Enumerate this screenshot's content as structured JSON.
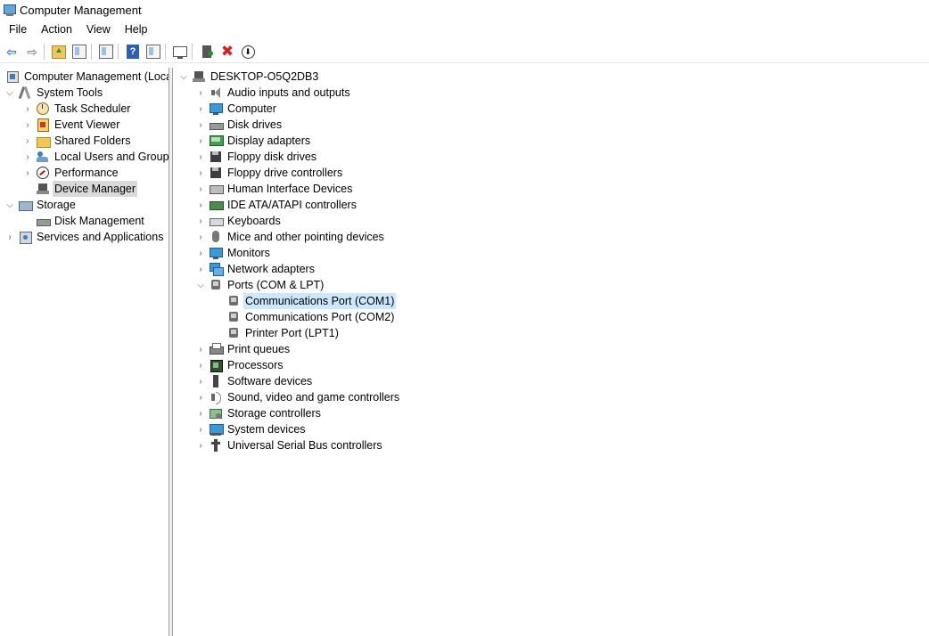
{
  "window": {
    "title": "Computer Management"
  },
  "menu": [
    "File",
    "Action",
    "View",
    "Help"
  ],
  "toolbar": [
    {
      "name": "back-icon"
    },
    {
      "name": "forward-icon"
    },
    {
      "name": "up-folder-icon"
    },
    {
      "name": "show-hide-tree-icon"
    },
    {
      "name": "export-list-icon"
    },
    {
      "name": "help-icon"
    },
    {
      "name": "action-pane-icon"
    },
    {
      "name": "scan-hardware-icon"
    },
    {
      "name": "update-driver-icon"
    },
    {
      "name": "uninstall-device-icon"
    },
    {
      "name": "disable-device-icon"
    }
  ],
  "left_tree": [
    {
      "label": "Computer Management (Local",
      "icon": "computer-management-icon",
      "depth": 0,
      "chev": ""
    },
    {
      "label": "System Tools",
      "icon": "system-tools-icon",
      "depth": 1,
      "chev": "open"
    },
    {
      "label": "Task Scheduler",
      "icon": "task-scheduler-icon",
      "depth": 2,
      "chev": "closed"
    },
    {
      "label": "Event Viewer",
      "icon": "event-viewer-icon",
      "depth": 2,
      "chev": "closed"
    },
    {
      "label": "Shared Folders",
      "icon": "shared-folders-icon",
      "depth": 2,
      "chev": "closed"
    },
    {
      "label": "Local Users and Groups",
      "icon": "local-users-icon",
      "depth": 2,
      "chev": "closed"
    },
    {
      "label": "Performance",
      "icon": "performance-icon",
      "depth": 2,
      "chev": "closed"
    },
    {
      "label": "Device Manager",
      "icon": "device-manager-icon",
      "depth": 2,
      "chev": "",
      "selected": true
    },
    {
      "label": "Storage",
      "icon": "storage-icon",
      "depth": 1,
      "chev": "open"
    },
    {
      "label": "Disk Management",
      "icon": "disk-management-icon",
      "depth": 2,
      "chev": ""
    },
    {
      "label": "Services and Applications",
      "icon": "services-icon",
      "depth": 1,
      "chev": "closed"
    }
  ],
  "device_tree": {
    "root": "DESKTOP-O5Q2DB3",
    "categories": [
      {
        "label": "Audio inputs and outputs",
        "icon": "audio-icon"
      },
      {
        "label": "Computer",
        "icon": "computer-icon"
      },
      {
        "label": "Disk drives",
        "icon": "disk-drive-icon"
      },
      {
        "label": "Display adapters",
        "icon": "display-adapter-icon"
      },
      {
        "label": "Floppy disk drives",
        "icon": "floppy-disk-icon"
      },
      {
        "label": "Floppy drive controllers",
        "icon": "floppy-controller-icon"
      },
      {
        "label": "Human Interface Devices",
        "icon": "hid-icon"
      },
      {
        "label": "IDE ATA/ATAPI controllers",
        "icon": "ide-controller-icon"
      },
      {
        "label": "Keyboards",
        "icon": "keyboard-icon"
      },
      {
        "label": "Mice and other pointing devices",
        "icon": "mouse-icon"
      },
      {
        "label": "Monitors",
        "icon": "monitor-icon"
      },
      {
        "label": "Network adapters",
        "icon": "network-adapter-icon"
      },
      {
        "label": "Ports (COM & LPT)",
        "icon": "port-icon",
        "expanded": true,
        "children": [
          {
            "label": "Communications Port (COM1)",
            "selected": true
          },
          {
            "label": "Communications Port (COM2)"
          },
          {
            "label": "Printer Port (LPT1)"
          }
        ]
      },
      {
        "label": "Print queues",
        "icon": "print-queue-icon"
      },
      {
        "label": "Processors",
        "icon": "processor-icon"
      },
      {
        "label": "Software devices",
        "icon": "software-device-icon"
      },
      {
        "label": "Sound, video and game controllers",
        "icon": "sound-icon"
      },
      {
        "label": "Storage controllers",
        "icon": "storage-controller-icon"
      },
      {
        "label": "System devices",
        "icon": "system-device-icon"
      },
      {
        "label": "Universal Serial Bus controllers",
        "icon": "usb-icon"
      }
    ]
  }
}
